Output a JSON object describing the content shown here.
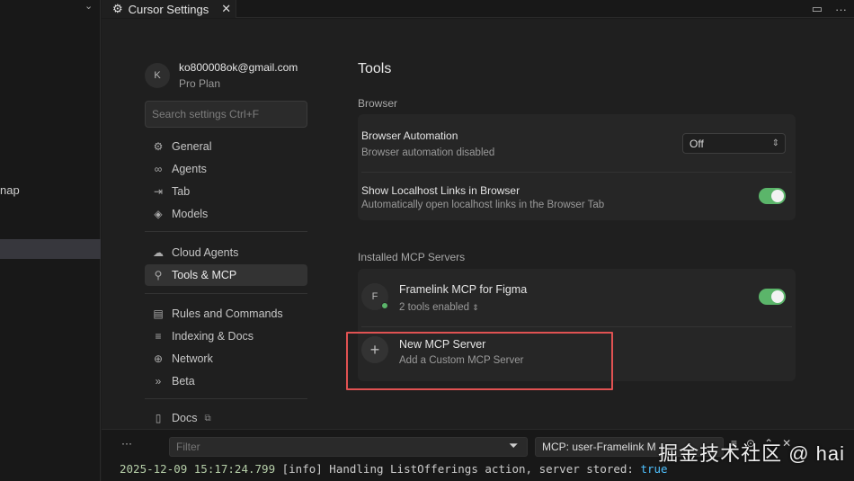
{
  "explorer": {
    "fragment_label": "nap"
  },
  "tab": {
    "title": "Cursor Settings",
    "close": "✕"
  },
  "user": {
    "avatar_initial": "K",
    "email": "ko800008ok@gmail.com",
    "plan": "Pro Plan"
  },
  "search": {
    "placeholder": "Search settings Ctrl+F"
  },
  "nav": {
    "group1": [
      {
        "label": "General",
        "icon": "gear-icon"
      },
      {
        "label": "Agents",
        "icon": "infinity-icon"
      },
      {
        "label": "Tab",
        "icon": "tab-arrow-icon"
      },
      {
        "label": "Models",
        "icon": "cube-icon"
      }
    ],
    "group2": [
      {
        "label": "Cloud Agents",
        "icon": "cloud-icon"
      },
      {
        "label": "Tools & MCP",
        "icon": "tools-icon",
        "active": true
      }
    ],
    "group3": [
      {
        "label": "Rules and Commands",
        "icon": "document-icon"
      },
      {
        "label": "Indexing & Docs",
        "icon": "database-icon"
      },
      {
        "label": "Network",
        "icon": "globe-icon"
      },
      {
        "label": "Beta",
        "icon": "double-chevron-icon"
      }
    ],
    "group4": [
      {
        "label": "Docs",
        "icon": "book-icon"
      }
    ]
  },
  "content": {
    "title": "Tools",
    "browser_section": "Browser",
    "browser_automation": {
      "title": "Browser Automation",
      "desc": "Browser automation disabled",
      "value": "Off"
    },
    "localhost_links": {
      "title": "Show Localhost Links in Browser",
      "desc": "Automatically open localhost links in the Browser Tab",
      "enabled": true
    },
    "mcp_section": "Installed MCP Servers",
    "mcp_servers": [
      {
        "initial": "F",
        "name": "Framelink MCP for Figma",
        "tools": "2 tools enabled",
        "enabled": true
      }
    ],
    "new_server": {
      "title": "New MCP Server",
      "desc": "Add a Custom MCP Server"
    }
  },
  "panel": {
    "filter_placeholder": "Filter",
    "channel": "MCP: user-Framelink M",
    "log": {
      "timestamp": "2025-12-09 15:17:24.799",
      "message": " [info] Handling ListOfferings action, server stored: ",
      "value": "true"
    }
  },
  "watermark": "掘金技术社区 @ hai",
  "colors": {
    "accent_toggle": "#5bb56a",
    "highlight": "#e05252"
  }
}
